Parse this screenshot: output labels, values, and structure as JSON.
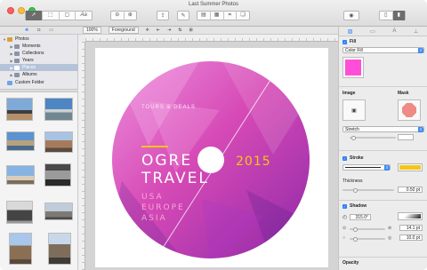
{
  "window": {
    "title": "Last Summer Photos"
  },
  "colors": {
    "accent": "#2f7df6",
    "fill": "#ff4fd8",
    "stroke": "#f5c518",
    "badge_yellow": "#f5c518"
  },
  "toolbar": {
    "tools": [
      "pointer-tool-icon",
      "rectangle-tool-icon",
      "square-tool-icon",
      "text-tool-icon"
    ],
    "text_tool_label": "Aa",
    "zoom": [
      "−",
      "+"
    ],
    "right_toggle_icon": "eye-icon"
  },
  "sidebar": {
    "tabs": [
      "photos-tab-icon",
      "camera-tab-icon",
      "folder-tab-icon"
    ],
    "items": [
      {
        "label": "Photos",
        "level": 0,
        "expanded": true
      },
      {
        "label": "Moments",
        "level": 1
      },
      {
        "label": "Collections",
        "level": 1
      },
      {
        "label": "Years",
        "level": 1
      },
      {
        "label": "Places",
        "level": 1,
        "selected": true
      },
      {
        "label": "Albums",
        "level": 1
      },
      {
        "label": "Custom Folder",
        "level": 0
      }
    ]
  },
  "canvas_bar": {
    "zoom": "100%",
    "layer": "Foreground"
  },
  "artwork": {
    "kicker": "TOURS & DEALS",
    "title_line1": "OGRE",
    "title_line2": "TRAVEL",
    "year": "2015",
    "places": [
      "USA",
      "EUROPE",
      "ASIA"
    ]
  },
  "inspector": {
    "fill": {
      "label": "Fill",
      "type": "Color Fill",
      "color": "#ff4fd8"
    },
    "image": {
      "label": "Image",
      "mask_label": "Mask",
      "mode": "Stretch"
    },
    "stroke": {
      "label": "Stroke",
      "thickness_label": "Thickness",
      "thickness": "0.50 pt",
      "color": "#f5c518"
    },
    "shadow": {
      "label": "Shadow",
      "angle": "315.0°",
      "offset": "14.1 pt",
      "blur": "10.0 pt"
    },
    "opacity": {
      "label": "Opacity"
    }
  }
}
